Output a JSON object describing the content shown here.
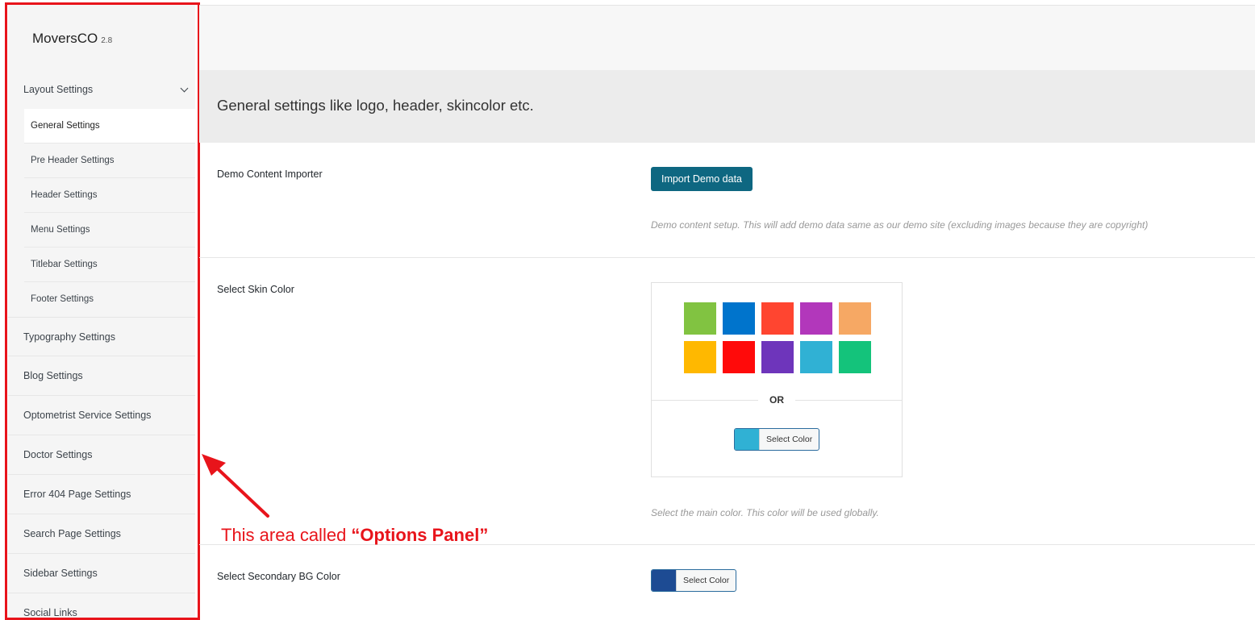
{
  "brand": {
    "name": "MoversCO",
    "version": "2.8"
  },
  "sidebar": {
    "expanded": {
      "label": "Layout Settings"
    },
    "subitems": [
      {
        "label": "General Settings"
      },
      {
        "label": "Pre Header Settings"
      },
      {
        "label": "Header Settings"
      },
      {
        "label": "Menu Settings"
      },
      {
        "label": "Titlebar Settings"
      },
      {
        "label": "Footer Settings"
      }
    ],
    "items": [
      {
        "label": "Typography Settings"
      },
      {
        "label": "Blog Settings"
      },
      {
        "label": "Optometrist Service Settings"
      },
      {
        "label": "Doctor Settings"
      },
      {
        "label": "Error 404 Page Settings"
      },
      {
        "label": "Search Page Settings"
      },
      {
        "label": "Sidebar Settings"
      },
      {
        "label": "Social Links"
      }
    ]
  },
  "section": {
    "title": "General settings like logo, header, skincolor etc."
  },
  "demo": {
    "label": "Demo Content Importer",
    "button": "Import Demo data",
    "description": "Demo content setup. This will add demo data same as our demo site (excluding images because they are copyright)"
  },
  "skin": {
    "label": "Select Skin Color",
    "swatches": [
      "#81c341",
      "#0074cc",
      "#ff4530",
      "#b237bb",
      "#f6a864",
      "#ffb800",
      "#ff0a0a",
      "#6e35bb",
      "#30b1d4",
      "#14c37b"
    ],
    "or_text": "OR",
    "picker_label": "Select Color",
    "picker_color": "#30b1d4",
    "description": "Select the main color. This color will be used globally."
  },
  "secondary": {
    "label": "Select Secondary BG Color",
    "picker_label": "Select Color",
    "picker_color": "#1d4b93"
  },
  "annotation": {
    "prefix": "This area called ",
    "emphasis": "“Options Panel”"
  }
}
